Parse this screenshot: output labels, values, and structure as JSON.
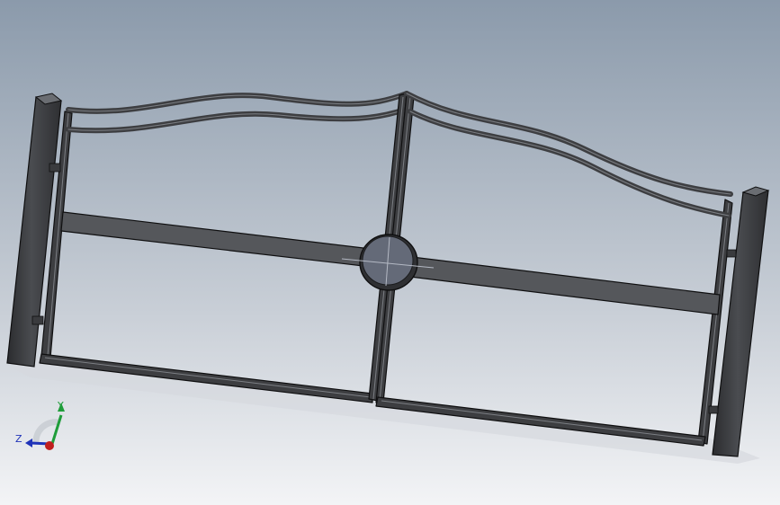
{
  "viewport": {
    "background_top": "#8b9aab",
    "background_mid": "#c9cfd7",
    "background_bottom": "#f3f4f6"
  },
  "model": {
    "part_fill": "#3d3e41",
    "part_face": "#55575b",
    "part_edge": "#0f0f10",
    "part_highlight": "#7c7f84",
    "hub_fill": "#646a78",
    "hub_centerline": "#b4b9c4"
  },
  "triad": {
    "x_color": "#c0201f",
    "y_color": "#1f9d3a",
    "z_color": "#1f33b8",
    "y_label": "Y",
    "z_label": "Z"
  }
}
